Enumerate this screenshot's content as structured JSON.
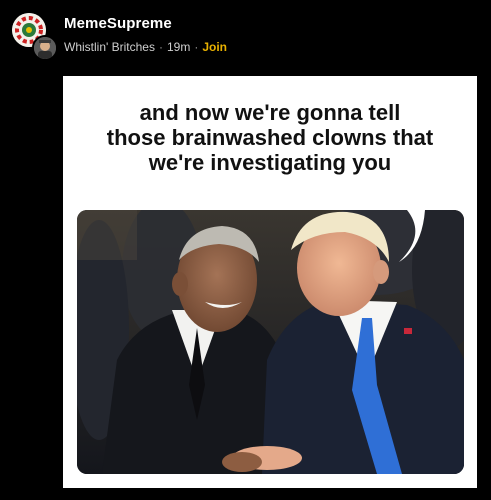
{
  "post": {
    "author": "MemeSupreme",
    "community": "Whistlin' Britches",
    "time": "19m",
    "separator": "·",
    "join_label": "Join"
  },
  "meme": {
    "caption_lines": [
      "and now we're gonna tell",
      "those brainwashed clowns that",
      "we're investigating you"
    ]
  },
  "icons": {
    "avatar": "avatar-icon",
    "community_avatar": "community-avatar-icon"
  },
  "colors": {
    "background": "#000000",
    "join": "#e8b100",
    "card": "#ffffff",
    "tie_blue": "#2f6fd6"
  }
}
